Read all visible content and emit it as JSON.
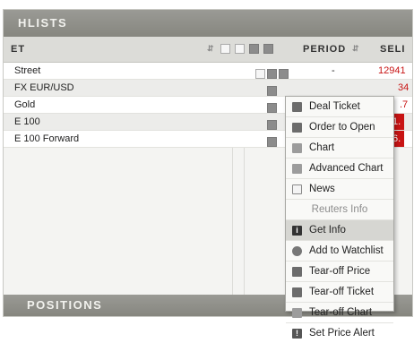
{
  "panel": {
    "title": "HLISTS"
  },
  "columns": {
    "market": "ET",
    "period": "PERIOD",
    "sell": "SELI"
  },
  "rows": [
    {
      "name": "Street",
      "period": "-",
      "sell": "12941"
    },
    {
      "name": "FX EUR/USD",
      "period": "",
      "sell": "34"
    },
    {
      "name": "Gold",
      "period": "",
      "sell": ".7"
    },
    {
      "name": "E 100",
      "period": "",
      "sell": "1."
    },
    {
      "name": "E 100 Forward",
      "period": "",
      "sell": "6."
    }
  ],
  "context_menu": {
    "items": [
      {
        "label": "Deal Ticket",
        "icon": "deal-ticket-icon"
      },
      {
        "label": "Order to Open",
        "icon": "order-icon"
      },
      {
        "label": "Chart",
        "icon": "chart-icon"
      },
      {
        "label": "Advanced Chart",
        "icon": "advanced-chart-icon"
      },
      {
        "label": "News",
        "icon": "news-icon"
      },
      {
        "label": "Reuters Info",
        "icon": ""
      },
      {
        "label": "Get Info",
        "icon": "info-icon"
      },
      {
        "label": "Add to Watchlist",
        "icon": "watchlist-icon"
      },
      {
        "label": "Tear-off Price",
        "icon": "tear-off-price-icon"
      },
      {
        "label": "Tear-off Ticket",
        "icon": "tear-off-ticket-icon"
      },
      {
        "label": "Tear-off Chart",
        "icon": "tear-off-chart-icon"
      },
      {
        "label": "Set Price Alert",
        "icon": "price-alert-icon"
      }
    ]
  },
  "positions": {
    "title": "POSITIONS"
  },
  "colors": {
    "sell_red": "#c81414",
    "header_gray": "#8f8f8a"
  }
}
